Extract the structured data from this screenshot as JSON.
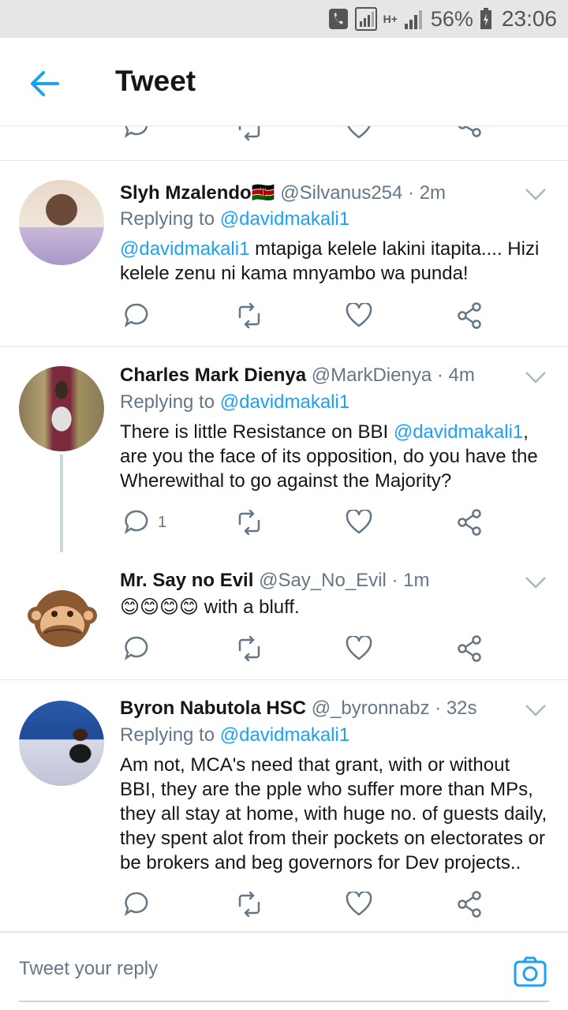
{
  "status_bar": {
    "battery": "56%",
    "network": "H+",
    "time": "23:06"
  },
  "header": {
    "title": "Tweet",
    "back_icon": "arrow-left-icon"
  },
  "colors": {
    "accent": "#1da1f2",
    "secondary_text": "#657786",
    "divider": "#e1e8ed"
  },
  "tweets": [
    {
      "name": "Slyh Mzalendo",
      "flag": "🇰🇪",
      "handle": "@Silvanus254",
      "time": "· 2m",
      "replying_label": "Replying to",
      "replying_to": "@davidmakali1",
      "mention": "@davidmakali1",
      "text": " mtapiga kelele lakini itapita.... Hizi kelele zenu ni kama mnyambo wa punda!",
      "reply_count": ""
    },
    {
      "name": "Charles Mark Dienya",
      "handle": "@MarkDienya",
      "time": "· 4m",
      "replying_label": "Replying to",
      "replying_to": "@davidmakali1",
      "text_before": "There is little Resistance on BBI ",
      "mention": "@davidmakali1",
      "text_after": ", are you the face of its opposition, do you have the Wherewithal to go against the Majority?",
      "reply_count": "1"
    },
    {
      "name": "Mr. Say no Evil",
      "handle": "@Say_No_Evil",
      "time": "· 1m",
      "emojis": "😊😊😊😊",
      "text": " with a bluff.",
      "reply_count": ""
    },
    {
      "name": "Byron Nabutola HSC",
      "handle": "@_byronnabz",
      "time": "· 32s",
      "replying_label": "Replying to",
      "replying_to": "@davidmakali1",
      "text": "Am not, MCA's need that grant, with or without BBI, they are the pple who suffer more than MPs, they all stay at home, with huge no. of guests daily, they spent alot from their pockets on electorates or be brokers and beg governors for Dev projects..",
      "reply_count": ""
    }
  ],
  "compose": {
    "placeholder": "Tweet your reply",
    "camera_icon": "camera-icon"
  }
}
